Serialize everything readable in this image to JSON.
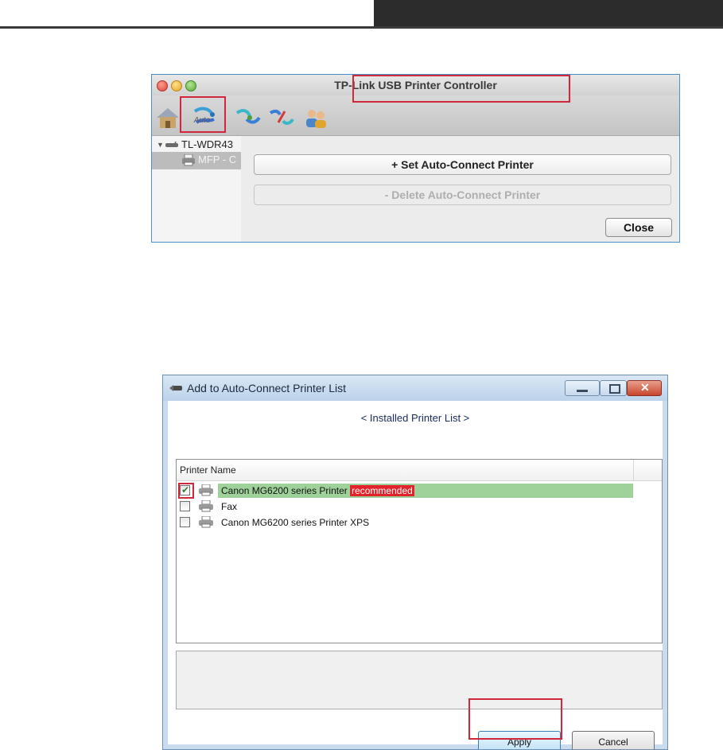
{
  "mac_window": {
    "title": "TP-Link USB Printer Controller",
    "toolbar": {
      "auto_label": "Auto",
      "icons": [
        "home-icon",
        "auto-connect-icon",
        "connect-icon",
        "disconnect-icon",
        "users-icon"
      ]
    },
    "tree": {
      "device": "TL-WDR43",
      "printer": "MFP - C"
    },
    "buttons": {
      "set_auto_connect": "+ Set Auto-Connect Printer",
      "delete_auto_connect": "- Delete Auto-Connect Printer",
      "close": "Close"
    }
  },
  "win_dialog": {
    "title": "Add to Auto-Connect Printer List",
    "list_title": "< Installed Printer List >",
    "column_header": "Printer Name",
    "printers": [
      {
        "name": "Canon MG6200 series Printer",
        "badge": "recommended",
        "checked": true,
        "selected": true
      },
      {
        "name": "Fax",
        "badge": "",
        "checked": false,
        "selected": false
      },
      {
        "name": "Canon MG6200 series Printer XPS",
        "badge": "",
        "checked": false,
        "selected": false
      }
    ],
    "buttons": {
      "apply": "Apply",
      "cancel": "Cancel"
    }
  },
  "colors": {
    "highlight_red": "#d0283a",
    "selection_green": "#9fd19a",
    "badge_red": "#e3232b"
  }
}
